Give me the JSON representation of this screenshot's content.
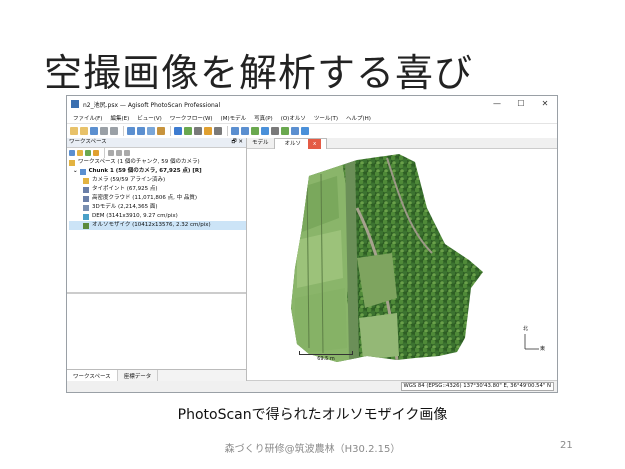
{
  "slide": {
    "title": "空撮画像を解析する喜び",
    "caption": "PhotoScanで得られたオルソモザイク画像",
    "footer": "森づくり研修@筑波農林（H30.2.15）",
    "page_number": "21"
  },
  "window": {
    "title": "n2_池尻.psx — Agisoft PhotoScan Professional",
    "controls": {
      "minimize": "—",
      "maximize": "☐",
      "close": "✕"
    },
    "menu": [
      "ファイル(F)",
      "編集(E)",
      "ビュー(V)",
      "ワークフロー(W)",
      "(M)モデル",
      "写真(P)",
      "(O)オルソ",
      "ツール(T)",
      "ヘルプ(H)"
    ],
    "toolbar_colors": [
      "#e8c26a",
      "#e8c26a",
      "#5b8fd0",
      "#9aa0a6",
      "#9aa0a6",
      "#5b8fd0",
      "#5b8fd0",
      "#7aa6d8",
      "#c7933d",
      "#3d7bd0",
      "#6aa84f",
      "#7a7a7a",
      "#e0a030",
      "#7a7a7a",
      "#5b8fd0",
      "#5b8fd0",
      "#6aa84f",
      "#4a90d9",
      "#7a7a7a",
      "#6aa84f",
      "#5b8fd0",
      "#4a90d9"
    ]
  },
  "workspace": {
    "panel_title": "ワークスペース",
    "panel_controls": "🗗 ✕",
    "root": "ワークスペース (1 個のチャンク, 59 個のカメラ)",
    "chunk": "Chunk 1 (59 個のカメラ, 67,925 点) [R]",
    "items": [
      {
        "label": "カメラ (59/59 アライン済み)",
        "icon_color": "#e3b341"
      },
      {
        "label": "タイポイント (67,925 点)",
        "icon_color": "#6b7fa8"
      },
      {
        "label": "高密度クラウド (11,071,806 点, 中 品質)",
        "icon_color": "#6b7fa8"
      },
      {
        "label": "3Dモデル (2,214,365 面)",
        "icon_color": "#7a8fb0"
      },
      {
        "label": "DEM (3141x3910, 9.27 cm/pix)",
        "icon_color": "#4aa0c8"
      },
      {
        "label": "オルソモザイク (10412x13576, 2.32 cm/pix)",
        "icon_color": "#5b8a3c"
      }
    ],
    "selected_index": 5
  },
  "bottom_tabs": [
    "ワークスペース",
    "座標データ"
  ],
  "view": {
    "tabs": [
      "モデル",
      "オルソ"
    ],
    "active_tab": "オルソ",
    "close_label": "x",
    "scale_label": "69.5 m",
    "north_label": "北",
    "east_label": "東",
    "status_coords": "WGS 84 (EPSG::4326)  137°30'43.80\" E, 36°49'00.54\" N"
  }
}
